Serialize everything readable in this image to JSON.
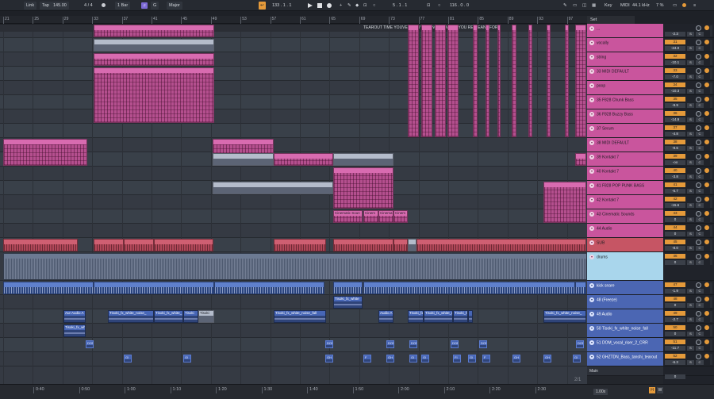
{
  "transport": {
    "link": "Link",
    "tap": "Tap",
    "tempo": "145.00",
    "sig_num": "4",
    "sig_slash": "/",
    "sig_den": "4",
    "quant": "1 Bar",
    "key_root": "G",
    "scale": "Major",
    "position": "133 .   1 .   1",
    "loop_start": "5 .   1 .   1",
    "loop_len": "116 .   0 .   0",
    "key": "Key",
    "midi": "MIDI",
    "samplerate": "44.1 kHz",
    "cpu": "7 %"
  },
  "arrangement": {
    "bar_numbers": [
      "21",
      "25",
      "29",
      "33",
      "37",
      "41",
      "45",
      "49",
      "53",
      "57",
      "61",
      "65",
      "69",
      "73",
      "77",
      "81",
      "85",
      "89",
      "93",
      "97"
    ],
    "locator_label": "TEAROUT TIME YOUVE BEEN WAITING ITS WHAT YOU RE MEANT FOR",
    "set_label": "Set",
    "clip_labels": {
      "cine1": "Cinematic Soun",
      "cine2": "Cinem",
      "cine3": "Cinema",
      "cine4": "Cinem",
      "aux": "Aur Audio A",
      "tis1": "Tisoki_fx_white_noise_",
      "tis2": "Tisoki_fx_white_",
      "tis3": "Tisoki",
      "tis4": "Tisoki_fx_white_noise_fall",
      "tis5": "Tisoki_fx_white_noise_",
      "tis6": "Tisoki_fx_white_noise_",
      "tis7": "Tisoki_fx_white_noise_",
      "tis8": "Tisoki_fx_white",
      "tisb": "Tisoki_fx_",
      "tisc": "Tisoki_fx_white",
      "audA": "Audio A",
      "dom": "DOM",
      "gh": "GH",
      "g": "GI",
      "f": "F",
      "fi": "FI"
    },
    "time_labels": [
      "0:40",
      "0:50",
      "1:00",
      "1:10",
      "1:20",
      "1:30",
      "1:40",
      "1:50",
      "2:00",
      "2:10",
      "2:20",
      "2:30"
    ],
    "page": "2/1",
    "zoom": "1.00x",
    "hw_h": "H",
    "hw_w": "W"
  },
  "tracks": [
    {
      "name": "...",
      "color": "pink",
      "num": "",
      "pan": "-2.3"
    },
    {
      "name": "vocally",
      "color": "pink",
      "num": "31",
      "pan": "-24.0"
    },
    {
      "name": "string",
      "color": "pink",
      "num": "32",
      "pan": "-10.1"
    },
    {
      "name": "33 MIDI DEFAULT",
      "color": "pink",
      "num": "33",
      "pan": "-7.0"
    },
    {
      "name": "poop",
      "color": "pink",
      "num": "34",
      "pan": "-10.3"
    },
    {
      "name": "35 F828 Chunk Bass",
      "color": "pink",
      "num": "35",
      "pan": "-9.9"
    },
    {
      "name": "36 F828 Buzzy Bass",
      "color": "pink",
      "num": "36",
      "pan": "-14.9"
    },
    {
      "name": "37 Serum",
      "color": "pink",
      "num": "37",
      "pan": "-4.8"
    },
    {
      "name": "38 MIDI DEFAULT",
      "color": "pink",
      "num": "38",
      "pan": "-9.6"
    },
    {
      "name": "39 Kontakt 7",
      "color": "pink",
      "num": "39",
      "pan": "-oo"
    },
    {
      "name": "40 Kontakt 7",
      "color": "pink",
      "num": "40",
      "pan": "-3.8"
    },
    {
      "name": "41 F828 POP PUNK BASS",
      "color": "pink",
      "num": "41",
      "pan": "-6.7"
    },
    {
      "name": "42 Kontakt 7",
      "color": "pink",
      "num": "42",
      "pan": "-15.6"
    },
    {
      "name": "43 Cinematic Sounds",
      "color": "pink",
      "num": "43",
      "pan": "0"
    },
    {
      "name": "44 Audio",
      "color": "pink",
      "num": "44",
      "pan": "0"
    },
    {
      "name": "SUB",
      "color": "red",
      "num": "45",
      "pan": "-8.0"
    },
    {
      "name": "drums",
      "color": "light",
      "num": "46",
      "pan": "0"
    },
    {
      "name": "kick snare",
      "color": "blue",
      "num": "47",
      "pan": "-1.9"
    },
    {
      "name": "48 (Freeze)",
      "color": "blue",
      "num": "48",
      "pan": "0"
    },
    {
      "name": "49 Audio",
      "color": "blue",
      "num": "49",
      "pan": "-2.7"
    },
    {
      "name": "50 Tisoki_fx_white_noise_fall",
      "color": "blue",
      "num": "50",
      "pan": "0"
    },
    {
      "name": "51 DOM_vocal_riser_2_CRR",
      "color": "blue",
      "num": "51",
      "pan": "-11.7"
    },
    {
      "name": "52 GHZTDN_Bass_tanshi_tearout",
      "color": "blue",
      "num": "52",
      "pan": "-6.3"
    },
    {
      "name": "Main",
      "color": "dark",
      "num": "",
      "pan": "0"
    }
  ],
  "mixer_labels": {
    "solo": "S",
    "cue": "C",
    "mute": "M"
  }
}
